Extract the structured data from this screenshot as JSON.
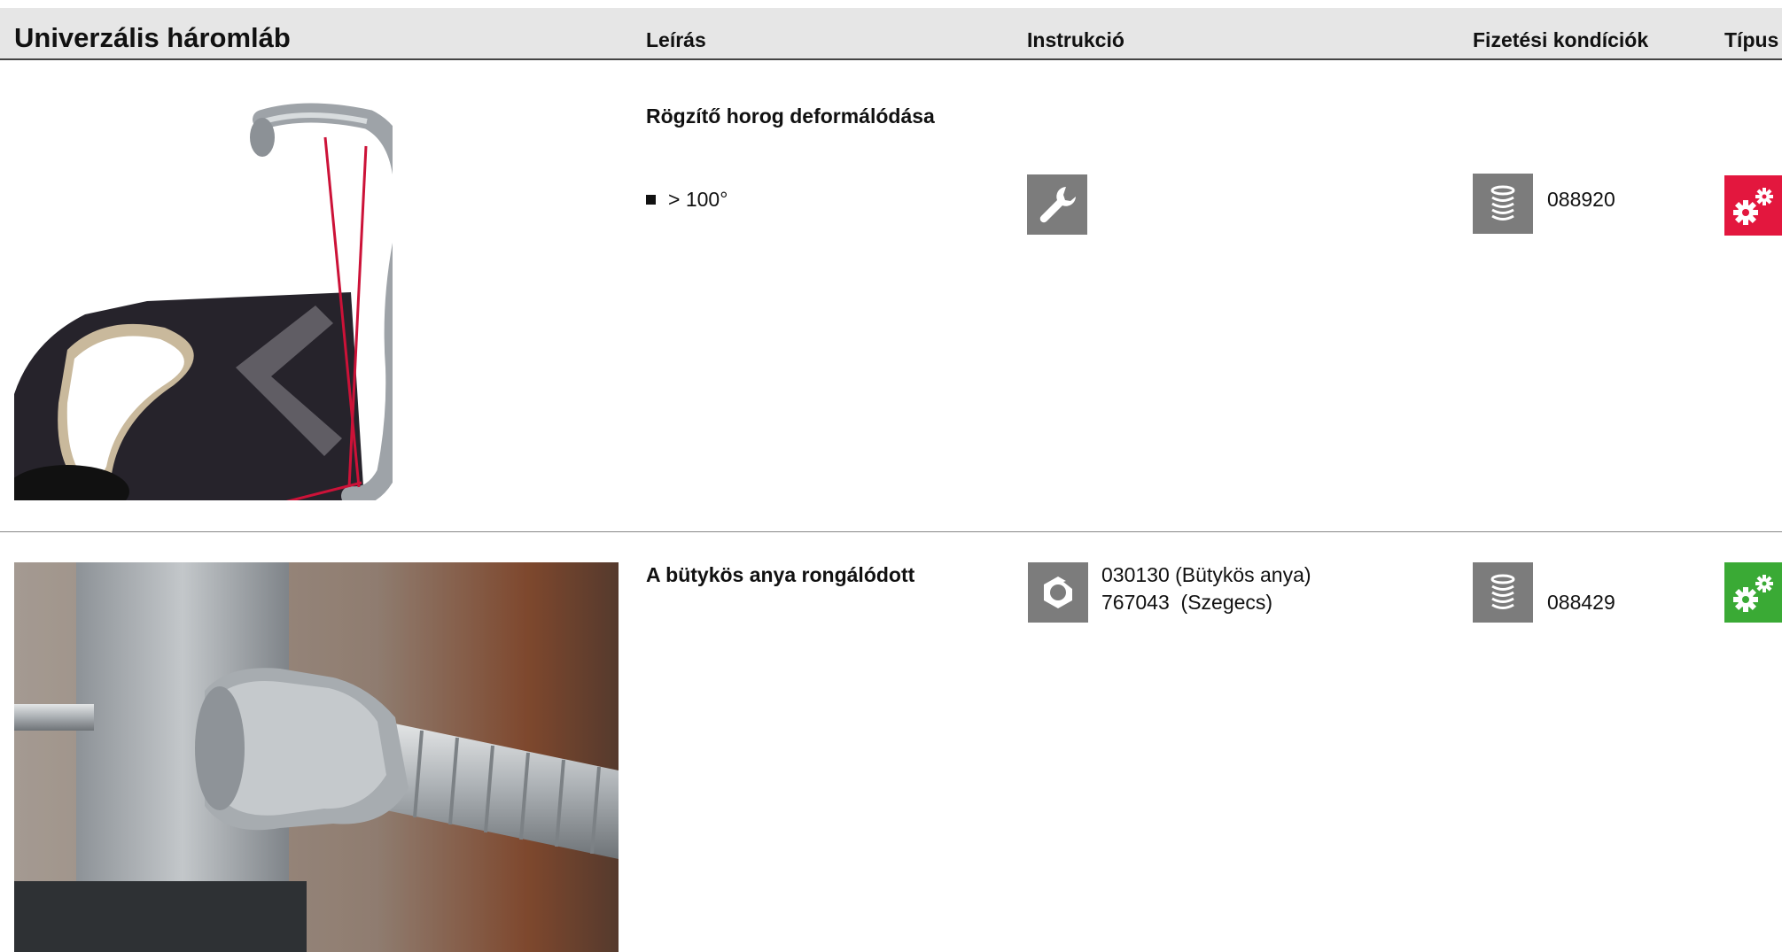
{
  "header": {
    "title": "Univerzális háromláb",
    "columns": {
      "description": "Leírás",
      "instruction": "Instrukció",
      "payment": "Fizetési kondíciók",
      "type": "Típus"
    }
  },
  "rows": [
    {
      "description_title": "Rögzítő horog deformálódása",
      "bullet": "> 100°",
      "instruction_icon": "wrench-icon",
      "payment_icon": "coin-stack-icon",
      "payment_code": "088920",
      "type_icon": "gears-icon",
      "type_color": "#e3173e"
    },
    {
      "description_title": "A bütykös anya rongálódott",
      "instruction_icon": "nut-icon",
      "instruction_lines": [
        "030130 (Bütykös anya)",
        "767043  (Szegecs)"
      ],
      "payment_icon": "coin-stack-icon",
      "payment_code": "088429",
      "type_icon": "gears-icon",
      "type_color": "#3aaa35"
    }
  ]
}
